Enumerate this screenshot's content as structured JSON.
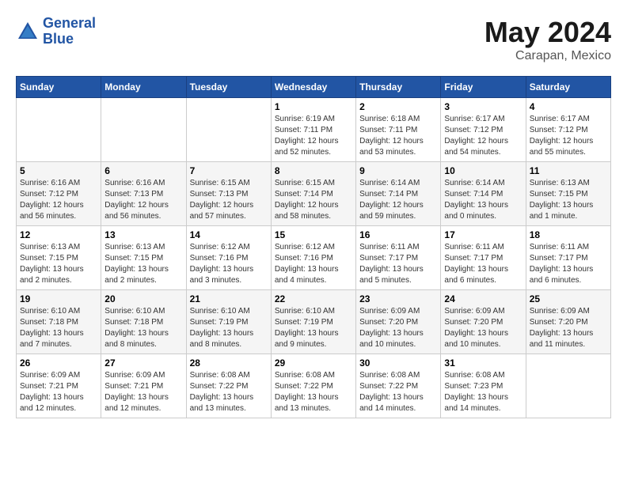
{
  "header": {
    "logo_line1": "General",
    "logo_line2": "Blue",
    "month": "May 2024",
    "location": "Carapan, Mexico"
  },
  "weekdays": [
    "Sunday",
    "Monday",
    "Tuesday",
    "Wednesday",
    "Thursday",
    "Friday",
    "Saturday"
  ],
  "weeks": [
    [
      {
        "day": "",
        "sunrise": "",
        "sunset": "",
        "daylight": ""
      },
      {
        "day": "",
        "sunrise": "",
        "sunset": "",
        "daylight": ""
      },
      {
        "day": "",
        "sunrise": "",
        "sunset": "",
        "daylight": ""
      },
      {
        "day": "1",
        "sunrise": "Sunrise: 6:19 AM",
        "sunset": "Sunset: 7:11 PM",
        "daylight": "Daylight: 12 hours and 52 minutes."
      },
      {
        "day": "2",
        "sunrise": "Sunrise: 6:18 AM",
        "sunset": "Sunset: 7:11 PM",
        "daylight": "Daylight: 12 hours and 53 minutes."
      },
      {
        "day": "3",
        "sunrise": "Sunrise: 6:17 AM",
        "sunset": "Sunset: 7:12 PM",
        "daylight": "Daylight: 12 hours and 54 minutes."
      },
      {
        "day": "4",
        "sunrise": "Sunrise: 6:17 AM",
        "sunset": "Sunset: 7:12 PM",
        "daylight": "Daylight: 12 hours and 55 minutes."
      }
    ],
    [
      {
        "day": "5",
        "sunrise": "Sunrise: 6:16 AM",
        "sunset": "Sunset: 7:12 PM",
        "daylight": "Daylight: 12 hours and 56 minutes."
      },
      {
        "day": "6",
        "sunrise": "Sunrise: 6:16 AM",
        "sunset": "Sunset: 7:13 PM",
        "daylight": "Daylight: 12 hours and 56 minutes."
      },
      {
        "day": "7",
        "sunrise": "Sunrise: 6:15 AM",
        "sunset": "Sunset: 7:13 PM",
        "daylight": "Daylight: 12 hours and 57 minutes."
      },
      {
        "day": "8",
        "sunrise": "Sunrise: 6:15 AM",
        "sunset": "Sunset: 7:14 PM",
        "daylight": "Daylight: 12 hours and 58 minutes."
      },
      {
        "day": "9",
        "sunrise": "Sunrise: 6:14 AM",
        "sunset": "Sunset: 7:14 PM",
        "daylight": "Daylight: 12 hours and 59 minutes."
      },
      {
        "day": "10",
        "sunrise": "Sunrise: 6:14 AM",
        "sunset": "Sunset: 7:14 PM",
        "daylight": "Daylight: 13 hours and 0 minutes."
      },
      {
        "day": "11",
        "sunrise": "Sunrise: 6:13 AM",
        "sunset": "Sunset: 7:15 PM",
        "daylight": "Daylight: 13 hours and 1 minute."
      }
    ],
    [
      {
        "day": "12",
        "sunrise": "Sunrise: 6:13 AM",
        "sunset": "Sunset: 7:15 PM",
        "daylight": "Daylight: 13 hours and 2 minutes."
      },
      {
        "day": "13",
        "sunrise": "Sunrise: 6:13 AM",
        "sunset": "Sunset: 7:15 PM",
        "daylight": "Daylight: 13 hours and 2 minutes."
      },
      {
        "day": "14",
        "sunrise": "Sunrise: 6:12 AM",
        "sunset": "Sunset: 7:16 PM",
        "daylight": "Daylight: 13 hours and 3 minutes."
      },
      {
        "day": "15",
        "sunrise": "Sunrise: 6:12 AM",
        "sunset": "Sunset: 7:16 PM",
        "daylight": "Daylight: 13 hours and 4 minutes."
      },
      {
        "day": "16",
        "sunrise": "Sunrise: 6:11 AM",
        "sunset": "Sunset: 7:17 PM",
        "daylight": "Daylight: 13 hours and 5 minutes."
      },
      {
        "day": "17",
        "sunrise": "Sunrise: 6:11 AM",
        "sunset": "Sunset: 7:17 PM",
        "daylight": "Daylight: 13 hours and 6 minutes."
      },
      {
        "day": "18",
        "sunrise": "Sunrise: 6:11 AM",
        "sunset": "Sunset: 7:17 PM",
        "daylight": "Daylight: 13 hours and 6 minutes."
      }
    ],
    [
      {
        "day": "19",
        "sunrise": "Sunrise: 6:10 AM",
        "sunset": "Sunset: 7:18 PM",
        "daylight": "Daylight: 13 hours and 7 minutes."
      },
      {
        "day": "20",
        "sunrise": "Sunrise: 6:10 AM",
        "sunset": "Sunset: 7:18 PM",
        "daylight": "Daylight: 13 hours and 8 minutes."
      },
      {
        "day": "21",
        "sunrise": "Sunrise: 6:10 AM",
        "sunset": "Sunset: 7:19 PM",
        "daylight": "Daylight: 13 hours and 8 minutes."
      },
      {
        "day": "22",
        "sunrise": "Sunrise: 6:10 AM",
        "sunset": "Sunset: 7:19 PM",
        "daylight": "Daylight: 13 hours and 9 minutes."
      },
      {
        "day": "23",
        "sunrise": "Sunrise: 6:09 AM",
        "sunset": "Sunset: 7:20 PM",
        "daylight": "Daylight: 13 hours and 10 minutes."
      },
      {
        "day": "24",
        "sunrise": "Sunrise: 6:09 AM",
        "sunset": "Sunset: 7:20 PM",
        "daylight": "Daylight: 13 hours and 10 minutes."
      },
      {
        "day": "25",
        "sunrise": "Sunrise: 6:09 AM",
        "sunset": "Sunset: 7:20 PM",
        "daylight": "Daylight: 13 hours and 11 minutes."
      }
    ],
    [
      {
        "day": "26",
        "sunrise": "Sunrise: 6:09 AM",
        "sunset": "Sunset: 7:21 PM",
        "daylight": "Daylight: 13 hours and 12 minutes."
      },
      {
        "day": "27",
        "sunrise": "Sunrise: 6:09 AM",
        "sunset": "Sunset: 7:21 PM",
        "daylight": "Daylight: 13 hours and 12 minutes."
      },
      {
        "day": "28",
        "sunrise": "Sunrise: 6:08 AM",
        "sunset": "Sunset: 7:22 PM",
        "daylight": "Daylight: 13 hours and 13 minutes."
      },
      {
        "day": "29",
        "sunrise": "Sunrise: 6:08 AM",
        "sunset": "Sunset: 7:22 PM",
        "daylight": "Daylight: 13 hours and 13 minutes."
      },
      {
        "day": "30",
        "sunrise": "Sunrise: 6:08 AM",
        "sunset": "Sunset: 7:22 PM",
        "daylight": "Daylight: 13 hours and 14 minutes."
      },
      {
        "day": "31",
        "sunrise": "Sunrise: 6:08 AM",
        "sunset": "Sunset: 7:23 PM",
        "daylight": "Daylight: 13 hours and 14 minutes."
      },
      {
        "day": "",
        "sunrise": "",
        "sunset": "",
        "daylight": ""
      }
    ]
  ]
}
